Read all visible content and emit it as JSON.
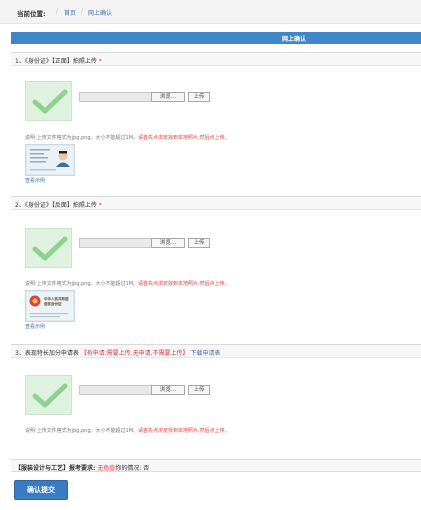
{
  "breadcrumb": {
    "label": "当前位置:",
    "sep1": "/",
    "home": "首页",
    "sep2": "/",
    "current": "网上确认"
  },
  "header": {
    "title": "网上确认"
  },
  "sections": [
    {
      "prefix": "1、《身份证》【正面】拍照上传",
      "required_mark": "*",
      "browse_label": "浏览...",
      "upload_label": "上传",
      "note_prefix": "说明:上传文件格式为jpg,png。大小不能超过1M。",
      "note_warning": "请首先点浏览找到本地照片,然后点上传。",
      "sample_link": "查看示例"
    },
    {
      "prefix": "2、《身份证》【反面】拍照上传",
      "required_mark": "*",
      "browse_label": "浏览...",
      "upload_label": "上传",
      "note_prefix": "说明:上传文件格式为jpg,png。大小不能超过1M。",
      "note_warning": "请首先点浏览找到本地照片,然后点上传。",
      "sample_link": "查看示例",
      "sample_text": "中华人民共和国 居民身份证"
    },
    {
      "prefix": "3、表现特长加分申请表",
      "bracket_text": "【有申请,需要上传,无申请,不需要上传】",
      "download_link": "下载申请表",
      "browse_label": "浏览...",
      "upload_label": "上传",
      "note_prefix": "说明:上传文件格式为jpg,png。大小不能超过1M。",
      "note_warning": "请首先点浏览找到本地照片,然后点上传。"
    }
  ],
  "footer": {
    "subject": "【服装设计与工艺】报考要求:",
    "requirement": "无色盲",
    "status_label": "你的情况:",
    "status_value": "否"
  },
  "submit_label": "确认提交",
  "colors": {
    "accent_blue": "#3f87c8",
    "required_red": "#e4393c",
    "thumb_green": "#dff2df",
    "check_green": "#8fd28f"
  },
  "icons": [
    "check-icon",
    "id-card-front-sample",
    "id-card-back-sample"
  ]
}
